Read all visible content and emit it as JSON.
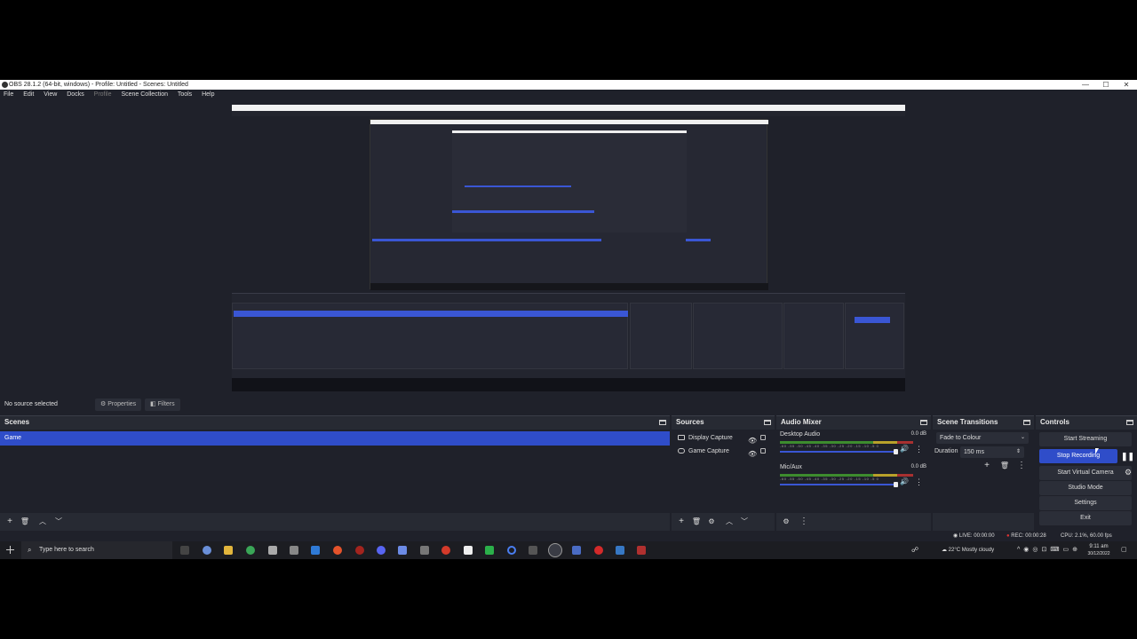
{
  "window": {
    "title": "OBS 28.1.2 (64-bit, windows) - Profile: Untitled - Scenes: Untitled",
    "min": "—",
    "max": "☐",
    "close": "✕"
  },
  "menu": {
    "items": [
      "File",
      "Edit",
      "View",
      "Docks",
      "Profile",
      "Scene Collection",
      "Tools",
      "Help"
    ]
  },
  "subbar": {
    "no_source": "No source selected",
    "properties": "Properties",
    "filters": "Filters"
  },
  "scenes": {
    "title": "Scenes",
    "items": [
      "Game"
    ]
  },
  "sources": {
    "title": "Sources",
    "items": [
      "Display Capture",
      "Game Capture"
    ]
  },
  "mixer": {
    "title": "Audio Mixer",
    "ticks": "-60 -55 -50 -45 -40 -35 -30 -25 -20 -15 -10 -5 0",
    "channels": [
      {
        "name": "Desktop Audio",
        "db": "0.0 dB"
      },
      {
        "name": "Mic/Aux",
        "db": "0.0 dB"
      }
    ]
  },
  "transitions": {
    "title": "Scene Transitions",
    "selected": "Fade to Colour",
    "duration_label": "Duration",
    "duration_value": "150 ms"
  },
  "controls": {
    "title": "Controls",
    "start_streaming": "Start Streaming",
    "stop_recording": "Stop Recording",
    "start_virtual_camera": "Start Virtual Camera",
    "studio_mode": "Studio Mode",
    "settings": "Settings",
    "exit": "Exit"
  },
  "status": {
    "live": "LIVE: 00:00:00",
    "rec": "REC: 00:00:28",
    "cpu": "CPU: 2.1%, 60.00 fps"
  },
  "taskbar": {
    "search_placeholder": "Type here to search",
    "weather": "22°C  Mostly cloudy",
    "time": "9:11 am",
    "date": "30/12/2022"
  },
  "colors": {
    "accent": "#2f4dc9",
    "background": "#1f212a",
    "panel": "#272a33"
  }
}
